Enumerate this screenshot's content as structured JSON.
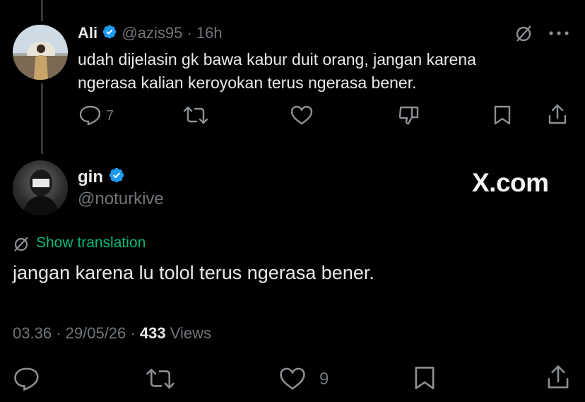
{
  "reply": {
    "name": "Ali",
    "handle": "@azis95",
    "time": "16h",
    "text_line1": "udah dijelasin gk bawa kabur duit orang, jangan karena",
    "text_line2": "ngerasa kalian keroyokan terus ngerasa bener.",
    "reply_count": "7"
  },
  "main": {
    "name": "gin",
    "handle": "@noturkive",
    "watermark": "X.com",
    "show_translation": "Show translation",
    "text": "jangan karena lu tolol terus ngerasa bener.",
    "time": "03.36",
    "date": "29/05/26",
    "views_count": "433",
    "views_label": "Views",
    "like_count": "9"
  },
  "colors": {
    "background": "#000000",
    "text": "#e7e9ea",
    "muted": "#71767b",
    "verified": "#1d9bf0",
    "translation": "#00ba7c"
  }
}
